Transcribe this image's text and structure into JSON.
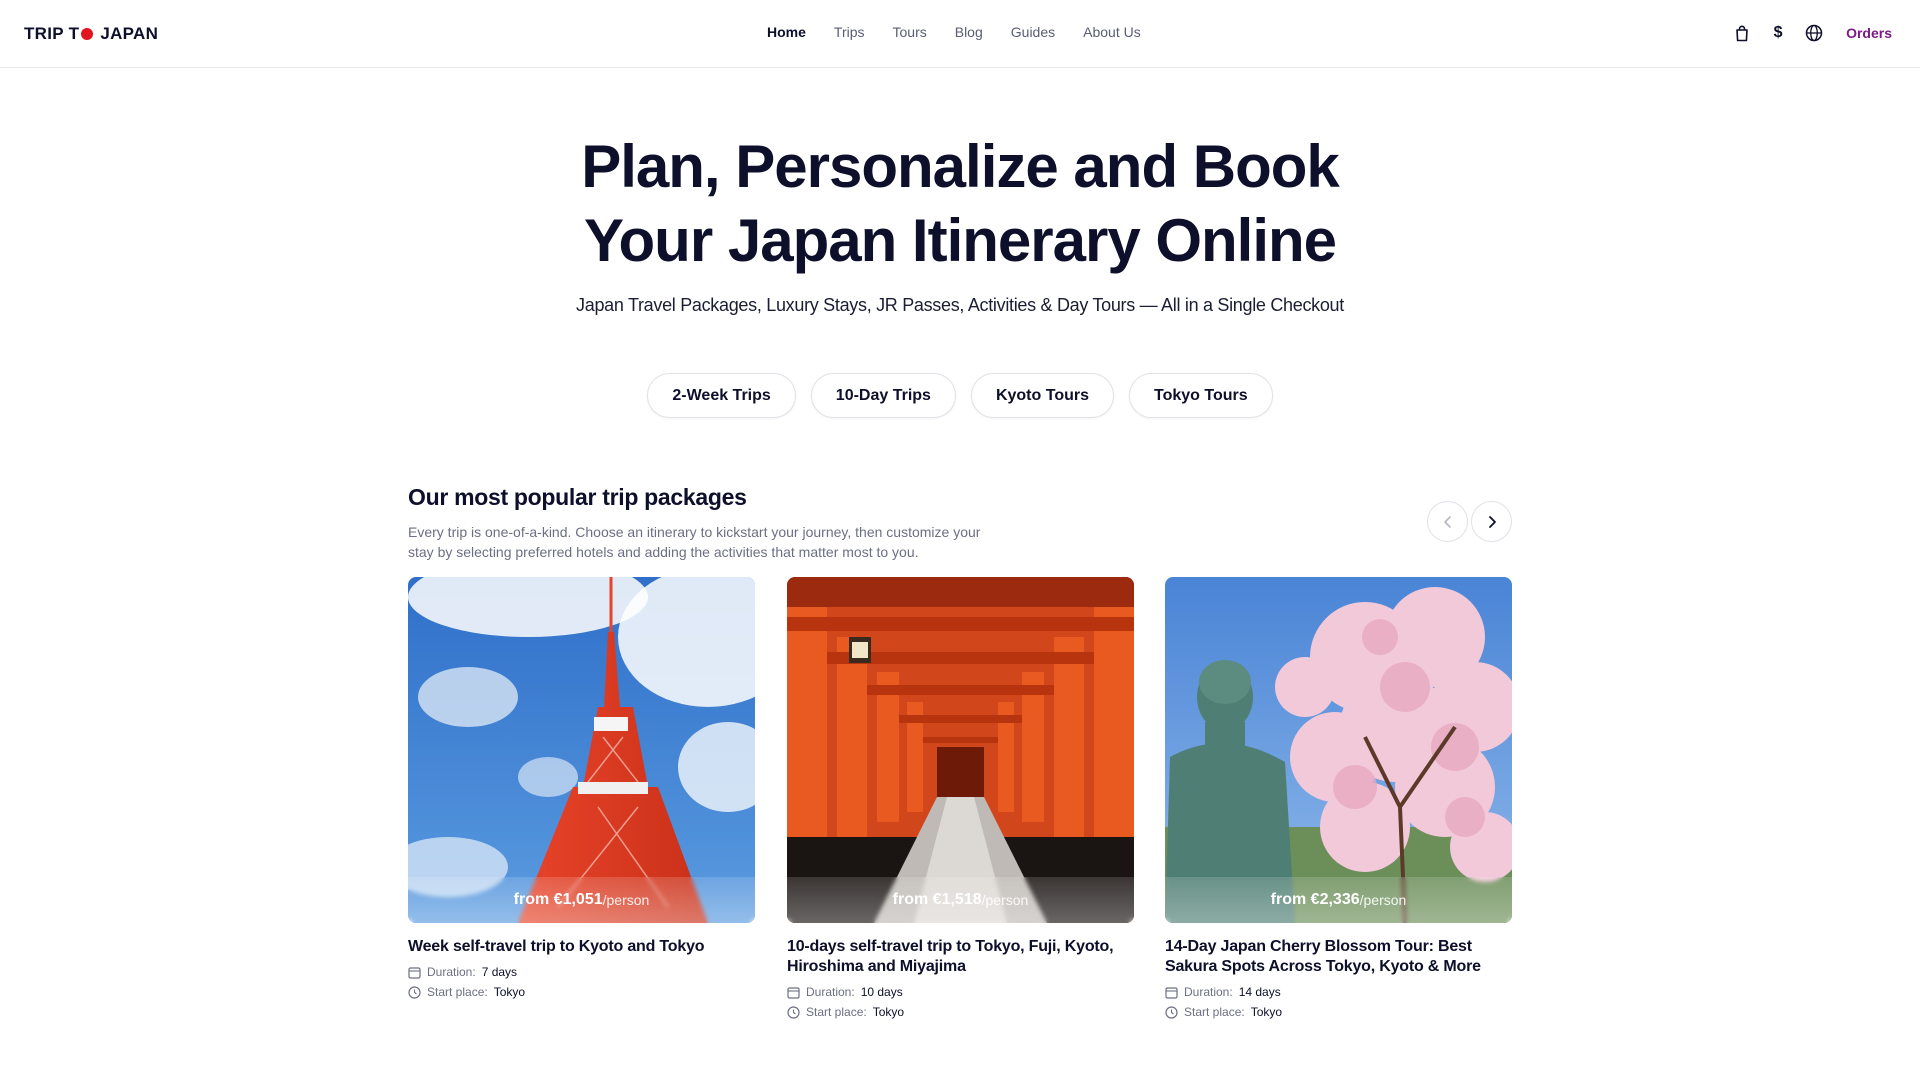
{
  "header": {
    "logo_part1": "TRIP T",
    "logo_part2": "JAPAN",
    "nav": [
      {
        "label": "Home"
      },
      {
        "label": "Trips"
      },
      {
        "label": "Tours"
      },
      {
        "label": "Blog"
      },
      {
        "label": "Guides"
      },
      {
        "label": "About Us"
      }
    ],
    "currency_symbol": "$",
    "orders_label": "Orders",
    "icons": [
      "bag-icon",
      "currency-icon",
      "globe-icon"
    ]
  },
  "hero": {
    "title_line1": "Plan, Personalize and Book",
    "title_line2": "Your Japan Itinerary Online",
    "subtitle": "Japan Travel Packages, Luxury Stays, JR Passes, Activities & Day Tours — All in a Single Checkout"
  },
  "quick_links": [
    {
      "label": "2-Week Trips"
    },
    {
      "label": "10-Day Trips"
    },
    {
      "label": "Kyoto Tours"
    },
    {
      "label": "Tokyo Tours"
    }
  ],
  "popular": {
    "title": "Our most popular trip packages",
    "description": "Every trip is one-of-a-kind. Choose an itinerary to kickstart your journey, then customize your stay by selecting preferred hotels and adding the activities that matter most to you.",
    "duration_label": "Duration:",
    "start_label": "Start place:",
    "cards": [
      {
        "price": "from €1,051",
        "per": "/person",
        "title": "Week self-travel trip to Kyoto and Tokyo",
        "duration": "7 days",
        "start": "Tokyo"
      },
      {
        "price": "from €1,518",
        "per": "/person",
        "title": "10-days self-travel trip to Tokyo, Fuji, Kyoto, Hiroshima and Miyajima",
        "duration": "10 days",
        "start": "Tokyo"
      },
      {
        "price": "from €2,336",
        "per": "/person",
        "title": "14-Day Japan Cherry Blossom Tour: Best Sakura Spots Across Tokyo, Kyoto & More",
        "duration": "14 days",
        "start": "Tokyo"
      }
    ]
  },
  "colors": {
    "brand_red": "#e0151f",
    "text_dark": "#0d0f2b",
    "orders_purple": "#7b1a86"
  }
}
